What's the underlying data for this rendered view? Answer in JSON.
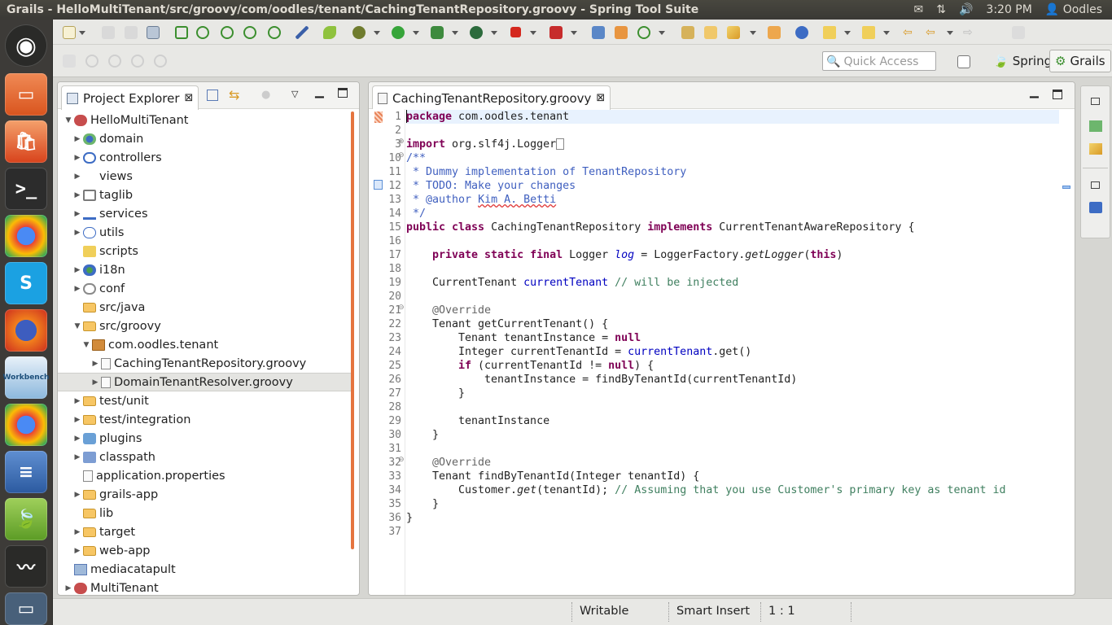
{
  "window_title": "Grails - HelloMultiTenant/src/groovy/com/oodles/tenant/CachingTenantRepository.groovy - Spring Tool Suite",
  "system": {
    "time": "3:20 PM",
    "user": "Oodles"
  },
  "toolbar": {
    "quick_access_placeholder": "Quick Access",
    "perspectives": [
      "Spring",
      "Grails"
    ]
  },
  "explorer": {
    "tab_label": "Project Explorer",
    "tree": [
      {
        "label": "HelloMultiTenant",
        "depth": 0,
        "arrow": "open",
        "icon": "project"
      },
      {
        "label": "domain",
        "depth": 1,
        "arrow": "closed",
        "icon": "domain"
      },
      {
        "label": "controllers",
        "depth": 1,
        "arrow": "closed",
        "icon": "controllers"
      },
      {
        "label": "views",
        "depth": 1,
        "arrow": "closed",
        "icon": "views"
      },
      {
        "label": "taglib",
        "depth": 1,
        "arrow": "closed",
        "icon": "taglib"
      },
      {
        "label": "services",
        "depth": 1,
        "arrow": "closed",
        "icon": "services"
      },
      {
        "label": "utils",
        "depth": 1,
        "arrow": "closed",
        "icon": "utils"
      },
      {
        "label": "scripts",
        "depth": 1,
        "arrow": "",
        "icon": "scripts"
      },
      {
        "label": "i18n",
        "depth": 1,
        "arrow": "closed",
        "icon": "globe"
      },
      {
        "label": "conf",
        "depth": 1,
        "arrow": "closed",
        "icon": "conf"
      },
      {
        "label": "src/java",
        "depth": 1,
        "arrow": "",
        "icon": "folder"
      },
      {
        "label": "src/groovy",
        "depth": 1,
        "arrow": "open",
        "icon": "folder"
      },
      {
        "label": "com.oodles.tenant",
        "depth": 2,
        "arrow": "open",
        "icon": "package"
      },
      {
        "label": "CachingTenantRepository.groovy",
        "depth": 3,
        "arrow": "closed",
        "icon": "file"
      },
      {
        "label": "DomainTenantResolver.groovy",
        "depth": 3,
        "arrow": "closed",
        "icon": "file",
        "selected": true
      },
      {
        "label": "test/unit",
        "depth": 1,
        "arrow": "closed",
        "icon": "folder"
      },
      {
        "label": "test/integration",
        "depth": 1,
        "arrow": "closed",
        "icon": "folder"
      },
      {
        "label": "plugins",
        "depth": 1,
        "arrow": "closed",
        "icon": "plugins"
      },
      {
        "label": "classpath",
        "depth": 1,
        "arrow": "closed",
        "icon": "classpath"
      },
      {
        "label": "application.properties",
        "depth": 1,
        "arrow": "",
        "icon": "file"
      },
      {
        "label": "grails-app",
        "depth": 1,
        "arrow": "closed",
        "icon": "folder"
      },
      {
        "label": "lib",
        "depth": 1,
        "arrow": "",
        "icon": "folder"
      },
      {
        "label": "target",
        "depth": 1,
        "arrow": "closed",
        "icon": "folder"
      },
      {
        "label": "web-app",
        "depth": 1,
        "arrow": "closed",
        "icon": "folder"
      },
      {
        "label": "mediacatapult",
        "depth": 0,
        "arrow": "",
        "icon": "projectclosed"
      },
      {
        "label": "MultiTenant",
        "depth": 0,
        "arrow": "closed",
        "icon": "project"
      }
    ]
  },
  "editor": {
    "tab_label": "CachingTenantRepository.groovy",
    "line_numbers": [
      "1",
      "2",
      "3",
      "10",
      "11",
      "12",
      "13",
      "14",
      "15",
      "16",
      "17",
      "18",
      "19",
      "20",
      "21",
      "22",
      "23",
      "24",
      "25",
      "26",
      "27",
      "28",
      "29",
      "30",
      "31",
      "32",
      "33",
      "34",
      "35",
      "36",
      "37"
    ],
    "code": {
      "l1_kw": "package",
      "l1_rest": " com.oodles.tenant",
      "l3_kw": "import",
      "l3_rest": " org.slf4j.Logger",
      "l10": "/**",
      "l11": " * Dummy implementation of TenantRepository",
      "l12": " * TODO: Make your changes",
      "l13_a": " * @author ",
      "l13_b": "Kim A. Betti",
      "l14": " */",
      "l15_kw1": "public class",
      "l15_name": " CachingTenantRepository ",
      "l15_kw2": "implements",
      "l15_rest": " CurrentTenantAwareRepository {",
      "l17_kw": "private static final",
      "l17_type": " Logger ",
      "l17_field": "log",
      "l17_eq": " = LoggerFactory.",
      "l17_method": "getLogger",
      "l17_open": "(",
      "l17_this": "this",
      "l17_close": ")",
      "l19_type": "CurrentTenant ",
      "l19_field": "currentTenant",
      "l19_comment": " // will be injected",
      "l21": "@Override",
      "l22": "Tenant getCurrentTenant() {",
      "l23_a": "Tenant tenantInstance = ",
      "l23_kw": "null",
      "l24_a": "Integer currentTenantId = ",
      "l24_field": "currentTenant",
      "l24_b": ".get()",
      "l25_kw": "if",
      "l25_a": " (currentTenantId != ",
      "l25_kw2": "null",
      "l25_b": ") {",
      "l26": "tenantInstance = findByTenantId(currentTenantId)",
      "l27": "}",
      "l29": "tenantInstance",
      "l30": "}",
      "l32": "@Override",
      "l33": "Tenant findByTenantId(Integer tenantId) {",
      "l34_a": "Customer.",
      "l34_method": "get",
      "l34_b": "(tenantId); ",
      "l34_comment": "// Assuming that you use Customer's primary key as tenant id",
      "l35": "}",
      "l36": "}"
    }
  },
  "status": {
    "writable": "Writable",
    "insert_mode": "Smart Insert",
    "position": "1 : 1"
  }
}
